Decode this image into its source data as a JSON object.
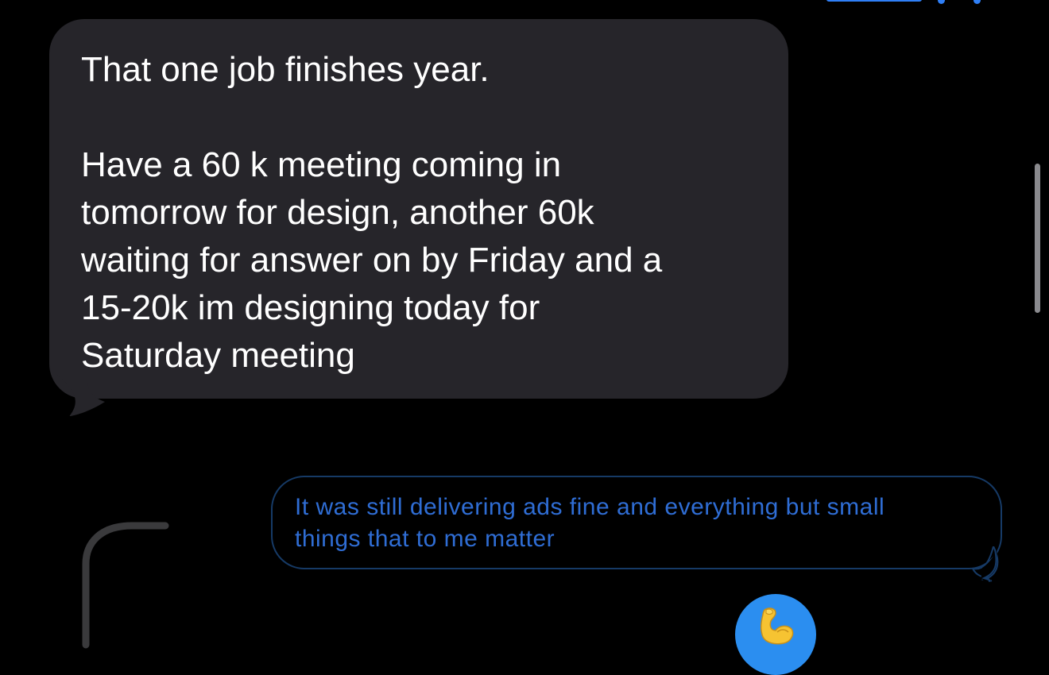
{
  "conversation": {
    "incoming_message": {
      "text": "That one job finishes year.\n\nHave a 60 k meeting coming in\ntomorrow for design, another 60k\nwaiting for answer on by Friday and a\n15-20k im designing today for\nSaturday meeting"
    },
    "outgoing_message": {
      "text": "It was still delivering ads fine and everything but small\nthings that to me matter"
    },
    "reaction": {
      "icon": "flexed-biceps-icon"
    }
  },
  "colors": {
    "background": "#000000",
    "incoming_bubble": "#26252a",
    "incoming_text": "#ffffff",
    "outgoing_border": "#163a66",
    "outgoing_text": "#2f6dd4",
    "reaction_bg": "#2b8ef0",
    "scroll_indicator": "#8a8a8e"
  }
}
